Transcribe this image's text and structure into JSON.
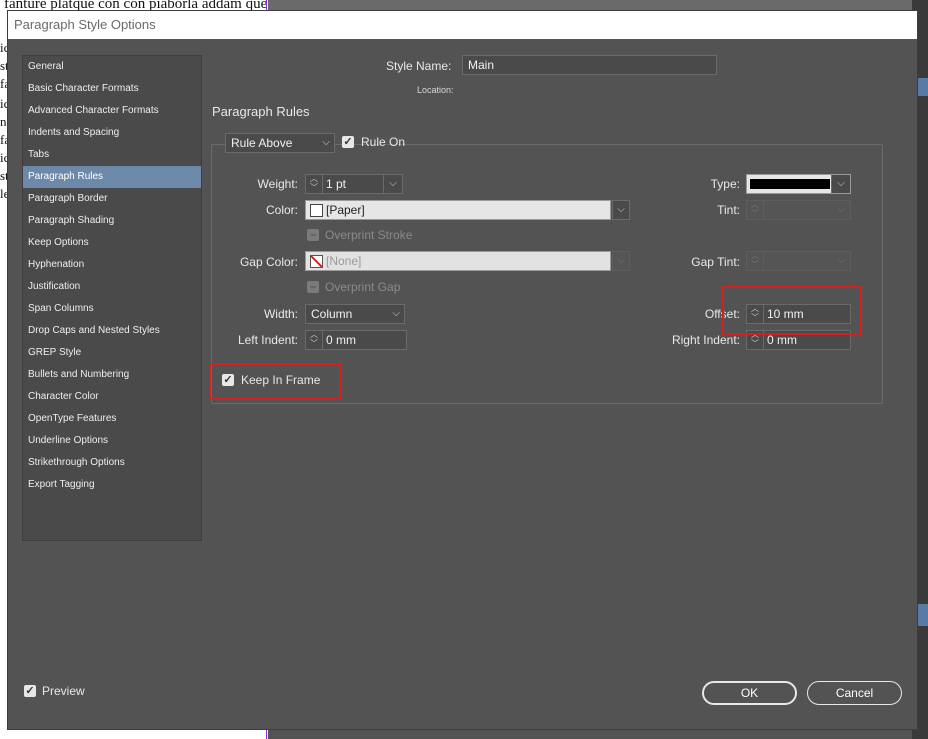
{
  "background": {
    "document_text": "fanture platque con con piaborla addam que",
    "fragments": [
      "ic",
      "st",
      "fa",
      "ic",
      "na",
      "fa",
      "ic",
      "st",
      "le"
    ]
  },
  "dialog": {
    "title": "Paragraph Style Options",
    "style_name_label": "Style Name:",
    "style_name_value": "Main",
    "location_label": "Location:",
    "section_title": "Paragraph Rules"
  },
  "categories": [
    {
      "label": "General"
    },
    {
      "label": "Basic Character Formats"
    },
    {
      "label": "Advanced Character Formats"
    },
    {
      "label": "Indents and Spacing"
    },
    {
      "label": "Tabs"
    },
    {
      "label": "Paragraph Rules",
      "selected": true
    },
    {
      "label": "Paragraph Border"
    },
    {
      "label": "Paragraph Shading"
    },
    {
      "label": "Keep Options"
    },
    {
      "label": "Hyphenation"
    },
    {
      "label": "Justification"
    },
    {
      "label": "Span Columns"
    },
    {
      "label": "Drop Caps and Nested Styles"
    },
    {
      "label": "GREP Style"
    },
    {
      "label": "Bullets and Numbering"
    },
    {
      "label": "Character Color"
    },
    {
      "label": "OpenType Features"
    },
    {
      "label": "Underline Options"
    },
    {
      "label": "Strikethrough Options"
    },
    {
      "label": "Export Tagging"
    }
  ],
  "rules": {
    "rule_type": "Rule Above",
    "rule_on_label": "Rule On",
    "rule_on_checked": true,
    "weight_label": "Weight:",
    "weight_value": "1 pt",
    "type_label": "Type:",
    "color_label": "Color:",
    "color_value": "[Paper]",
    "tint_label": "Tint:",
    "tint_value": "",
    "overprint_stroke_label": "Overprint Stroke",
    "gap_color_label": "Gap Color:",
    "gap_color_value": "[None]",
    "gap_tint_label": "Gap Tint:",
    "gap_tint_value": "",
    "overprint_gap_label": "Overprint Gap",
    "width_label": "Width:",
    "width_value": "Column",
    "offset_label": "Offset:",
    "offset_value": "10 mm",
    "left_indent_label": "Left Indent:",
    "left_indent_value": "0 mm",
    "right_indent_label": "Right Indent:",
    "right_indent_value": "0 mm",
    "keep_in_frame_label": "Keep In Frame",
    "keep_in_frame_checked": true
  },
  "footer": {
    "preview_label": "Preview",
    "preview_checked": true,
    "ok_label": "OK",
    "cancel_label": "Cancel"
  },
  "colors": {
    "dialog_bg": "#535353",
    "selection": "#6d89aa",
    "highlight": "#d61f1f"
  }
}
